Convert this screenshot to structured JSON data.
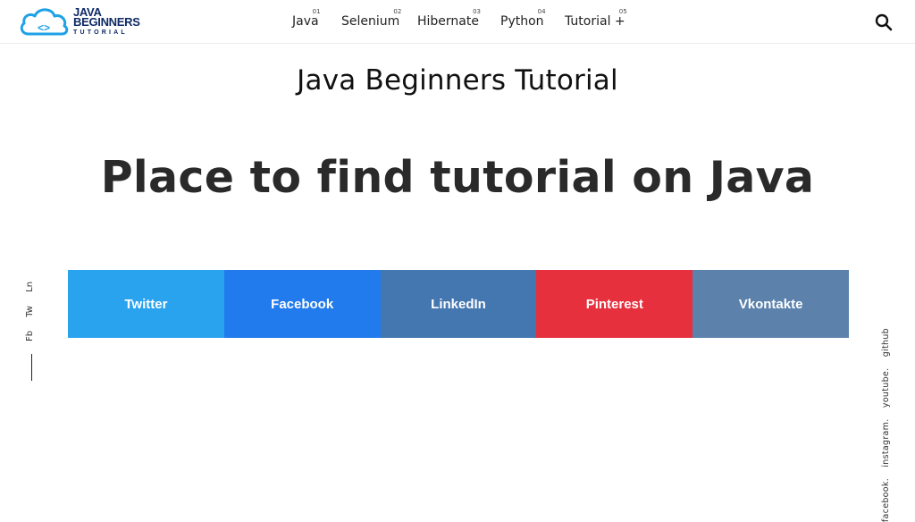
{
  "logo": {
    "line1": "JAVA",
    "line2": "BEGINNERS",
    "line3": "TUTORIAL",
    "brand_color": "#0e2a66",
    "cloud_color": "#1da1e6"
  },
  "nav": {
    "items": [
      {
        "num": "01",
        "label": "Java"
      },
      {
        "num": "02",
        "label": "Selenium"
      },
      {
        "num": "03",
        "label": "Hibernate"
      },
      {
        "num": "04",
        "label": "Python"
      },
      {
        "num": "05",
        "label": "Tutorial +"
      }
    ],
    "search_icon": "search-icon"
  },
  "site_title": "Java Beginners Tutorial",
  "hero_text": "Place to find tutorial on Java",
  "share_buttons": [
    {
      "label": "Twitter",
      "color": "#2aa3ef"
    },
    {
      "label": "Facebook",
      "color": "#227bed"
    },
    {
      "label": "LinkedIn",
      "color": "#4477b0"
    },
    {
      "label": "Pinterest",
      "color": "#e7303e"
    },
    {
      "label": "Vkontakte",
      "color": "#5c82ac"
    }
  ],
  "left_social": [
    "Fb",
    "Tw",
    "Ln"
  ],
  "right_social": [
    "facebook.",
    "instagram.",
    "youtube.",
    "github"
  ]
}
